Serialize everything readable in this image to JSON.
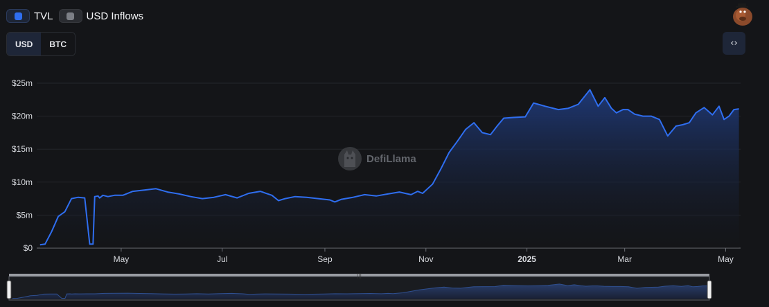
{
  "legend": {
    "tvl_label": "TVL",
    "inflows_label": "USD Inflows"
  },
  "denomination": {
    "usd_label": "USD",
    "btc_label": "BTC",
    "active": "USD"
  },
  "embed_button": {
    "label": "‹›",
    "icon": "code-icon"
  },
  "watermark": {
    "text": "DefiLlama"
  },
  "colors": {
    "line": "#2f6ef0",
    "area_top": "#1f3a7a",
    "area_bottom": "#141518",
    "grid": "#24262b",
    "axis_text": "#d7d9de",
    "background": "#141518"
  },
  "chart_data": {
    "type": "area",
    "title": "",
    "xlabel": "",
    "ylabel": "",
    "series": [
      {
        "name": "TVL",
        "x": [
          "2024-03-13",
          "2024-03-16",
          "2024-03-20",
          "2024-03-24",
          "2024-03-28",
          "2024-04-01",
          "2024-04-05",
          "2024-04-09",
          "2024-04-12",
          "2024-04-14",
          "2024-04-15",
          "2024-04-17",
          "2024-04-18",
          "2024-04-20",
          "2024-04-23",
          "2024-04-27",
          "2024-05-02",
          "2024-05-08",
          "2024-05-15",
          "2024-05-22",
          "2024-05-29",
          "2024-06-05",
          "2024-06-12",
          "2024-06-19",
          "2024-06-26",
          "2024-07-03",
          "2024-07-10",
          "2024-07-17",
          "2024-07-24",
          "2024-07-31",
          "2024-08-04",
          "2024-08-08",
          "2024-08-14",
          "2024-08-21",
          "2024-08-28",
          "2024-09-04",
          "2024-09-07",
          "2024-09-11",
          "2024-09-18",
          "2024-09-25",
          "2024-10-02",
          "2024-10-09",
          "2024-10-16",
          "2024-10-23",
          "2024-10-27",
          "2024-10-30",
          "2024-11-05",
          "2024-11-10",
          "2024-11-15",
          "2024-11-20",
          "2024-11-25",
          "2024-11-30",
          "2024-12-05",
          "2024-12-10",
          "2024-12-14",
          "2024-12-18",
          "2024-12-24",
          "2024-12-31",
          "2025-01-05",
          "2025-01-12",
          "2025-01-20",
          "2025-01-26",
          "2025-02-01",
          "2025-02-08",
          "2025-02-13",
          "2025-02-17",
          "2025-02-21",
          "2025-02-24",
          "2025-02-28",
          "2025-03-03",
          "2025-03-07",
          "2025-03-12",
          "2025-03-17",
          "2025-03-22",
          "2025-03-27",
          "2025-04-01",
          "2025-04-05",
          "2025-04-09",
          "2025-04-13",
          "2025-04-18",
          "2025-04-23",
          "2025-04-27",
          "2025-04-30",
          "2025-05-03",
          "2025-05-06",
          "2025-05-09"
        ],
        "values": [
          0.5,
          0.6,
          2.5,
          4.8,
          5.5,
          7.5,
          7.7,
          7.6,
          0.6,
          0.6,
          7.8,
          7.9,
          7.6,
          8.0,
          7.8,
          8.0,
          8.0,
          8.6,
          8.8,
          9.0,
          8.5,
          8.2,
          7.8,
          7.5,
          7.7,
          8.1,
          7.6,
          8.3,
          8.6,
          8.0,
          7.2,
          7.5,
          7.8,
          7.7,
          7.5,
          7.3,
          7.0,
          7.4,
          7.7,
          8.1,
          7.9,
          8.2,
          8.5,
          8.1,
          8.6,
          8.3,
          9.7,
          12.0,
          14.5,
          16.2,
          18.0,
          19.0,
          17.5,
          17.2,
          18.5,
          19.7,
          19.8,
          19.9,
          22.0,
          21.5,
          21.0,
          21.2,
          21.8,
          24.0,
          21.5,
          22.8,
          21.2,
          20.5,
          21.0,
          21.0,
          20.3,
          20.0,
          20.0,
          19.5,
          17.0,
          18.5,
          18.7,
          19.0,
          20.5,
          21.3,
          20.2,
          21.5,
          19.5,
          20.0,
          21.0,
          21.1
        ]
      }
    ],
    "x_ticks": [
      "May",
      "Jul",
      "Sep",
      "Nov",
      "2025",
      "Mar",
      "May"
    ],
    "y_ticks": [
      "$0",
      "$5m",
      "$10m",
      "$15m",
      "$20m",
      "$25m"
    ],
    "ylim": [
      0,
      25
    ],
    "xlim": [
      "2024-03-11",
      "2025-05-10"
    ],
    "grid": true,
    "legend_position": "top-left"
  }
}
